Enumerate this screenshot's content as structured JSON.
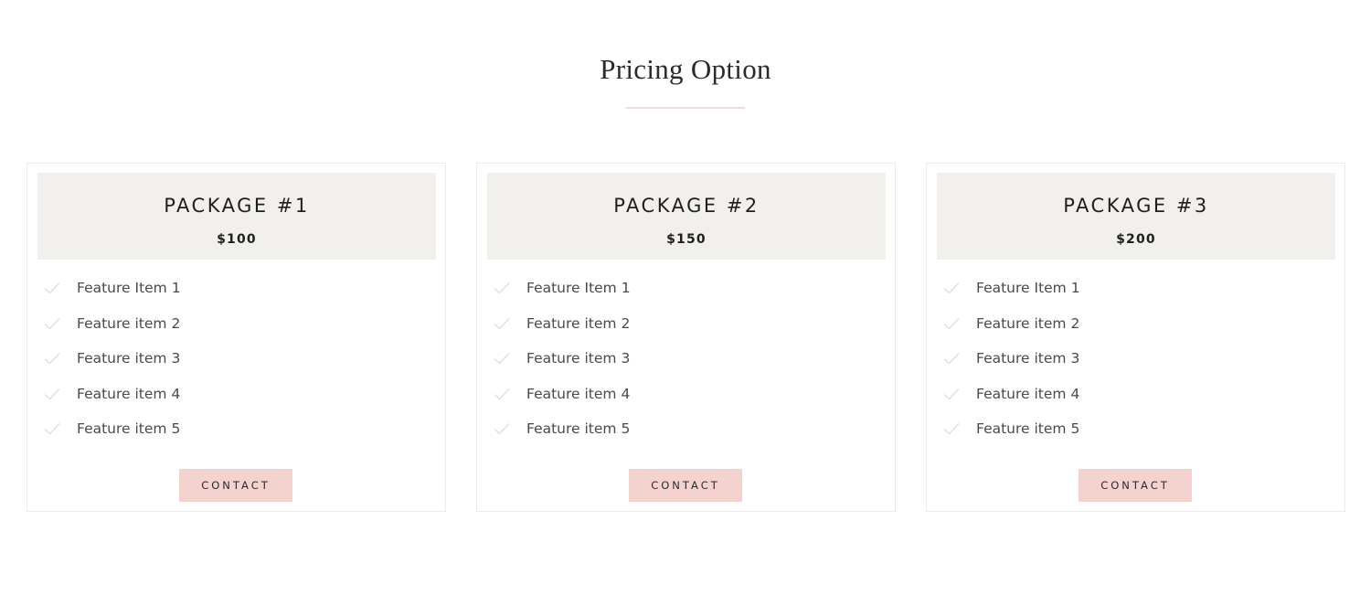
{
  "section": {
    "title": "Pricing Option",
    "divider_color": "#f0ddd8"
  },
  "packages": [
    {
      "name": "PACKAGE #1",
      "price": "$100",
      "features": [
        "Feature Item 1",
        "Feature item 2",
        "Feature item 3",
        "Feature item 4",
        "Feature item 5"
      ],
      "button_label": "CONTACT"
    },
    {
      "name": "PACKAGE #2",
      "price": "$150",
      "features": [
        "Feature Item 1",
        "Feature item 2",
        "Feature item 3",
        "Feature item 4",
        "Feature item 5"
      ],
      "button_label": "CONTACT"
    },
    {
      "name": "PACKAGE #3",
      "price": "$200",
      "features": [
        "Feature Item 1",
        "Feature item 2",
        "Feature item 3",
        "Feature item 4",
        "Feature item 5"
      ],
      "button_label": "CONTACT"
    }
  ],
  "colors": {
    "header_bg": "#f1f0ec",
    "button_bg": "#f4d3cf",
    "check_icon": "#e0e0e0"
  },
  "icons": {
    "feature": "check-icon"
  }
}
